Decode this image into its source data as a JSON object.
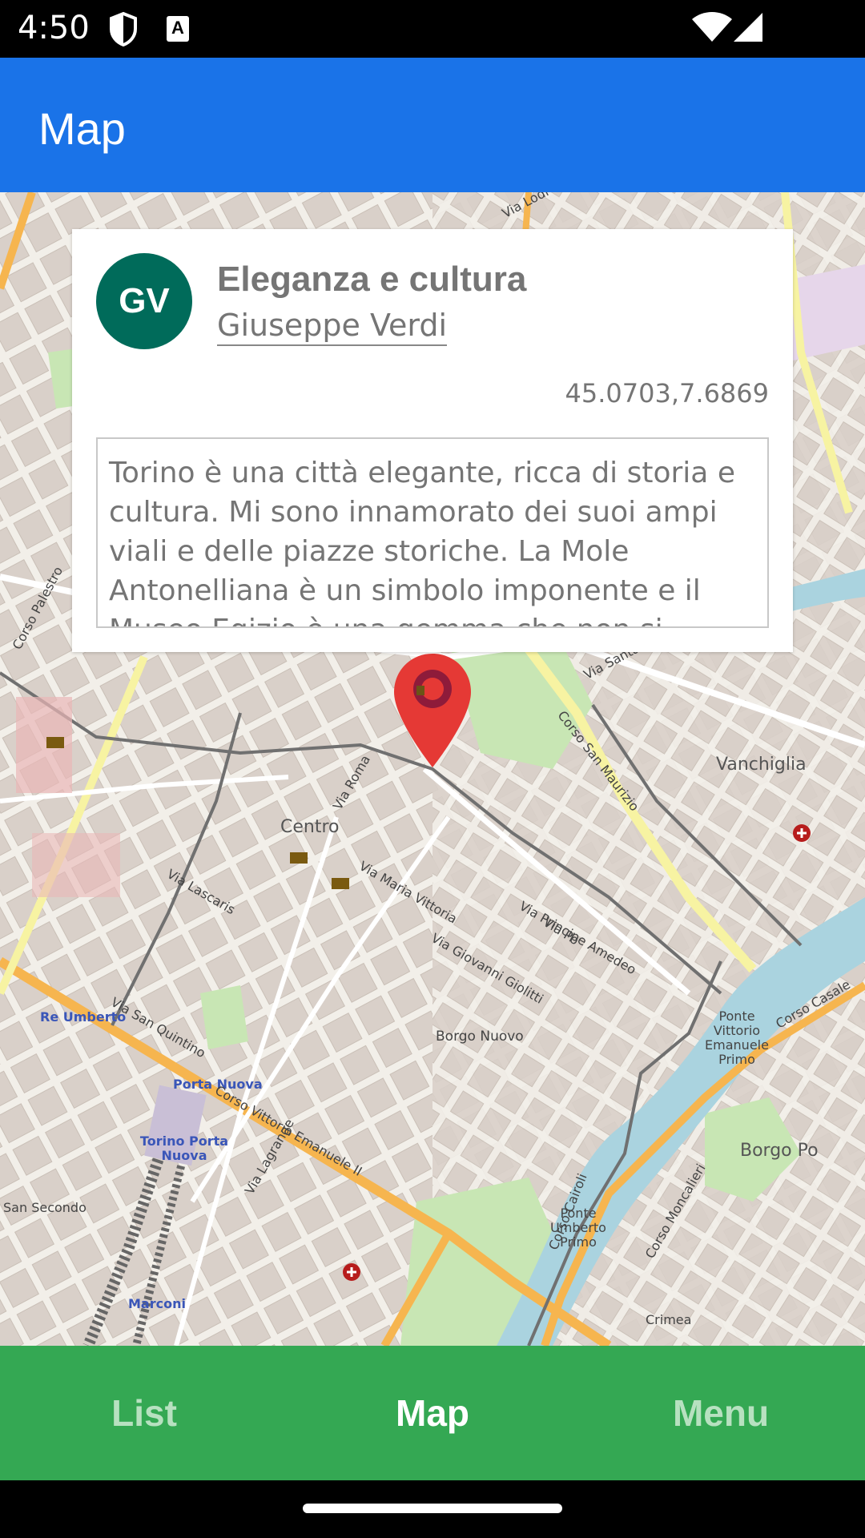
{
  "status_bar": {
    "time": "4:50",
    "icons": [
      "shield-icon",
      "a-icon",
      "wifi-icon",
      "signal-icon"
    ]
  },
  "app_bar": {
    "title": "Map"
  },
  "card": {
    "avatar_initials": "GV",
    "title": "Eleganza e cultura",
    "author": "Giuseppe Verdi",
    "coordinates": "45.0703,7.6869",
    "text": "Torino è una città elegante, ricca di storia e cultura. Mi sono innamorato dei suoi ampi viali e delle piazze storiche. La Mole Antonelliana è un simbolo imponente e il Museo Egizio è una gemma che non si"
  },
  "map": {
    "marker_icon": "location-pin-icon",
    "labels": {
      "centro": "Centro",
      "vanchiglia": "Vanchiglia",
      "borgo_nuovo": "Borgo Nuovo",
      "borgo_po": "Borgo Po",
      "porta_nuova": "Porta Nuova",
      "torino_porta_nuova": "Torino Porta Nuova",
      "re_umberto": "Re Umberto",
      "marconi": "Marconi",
      "san_secondo": "San Secondo",
      "ponte_vittorio": "Ponte Vittorio Emanuele Primo",
      "ponte_umberto": "Ponte Umberto Primo",
      "crimea": "Crimea",
      "via_po": "Via Po",
      "via_roma": "Via Roma",
      "via_maria_vittoria": "Via Maria Vittoria",
      "via_giovanni_giolitti": "Via Giovanni Giolitti",
      "via_principe_amedeo": "Via Principe Amedeo",
      "corso_san_maurizio": "Corso San Maurizio",
      "corso_vittorio_emanuele": "Corso Vittorio Emanuele II",
      "via_santa_giulia": "Via Santa Giulia",
      "corso_cairoli": "Corso Cairoli",
      "corso_moncalieri": "Corso Moncalieri",
      "corso_casale": "Corso Casale",
      "via_lagrange": "Via Lagrange",
      "via_lodi": "Via Lodi",
      "via_san_quintino": "Via San Quintino",
      "via_lascaris": "Via Lascaris",
      "corso_palestro": "Corso Palestro"
    }
  },
  "bottom_nav": {
    "items": [
      {
        "label": "List",
        "active": false
      },
      {
        "label": "Map",
        "active": true
      },
      {
        "label": "Menu",
        "active": false
      }
    ]
  },
  "colors": {
    "app_bar": "#1a73e8",
    "bottom_nav": "#34a853",
    "avatar": "#006b5a",
    "marker": "#e53935",
    "river": "#aad3df",
    "park": "#c8e6b4"
  }
}
